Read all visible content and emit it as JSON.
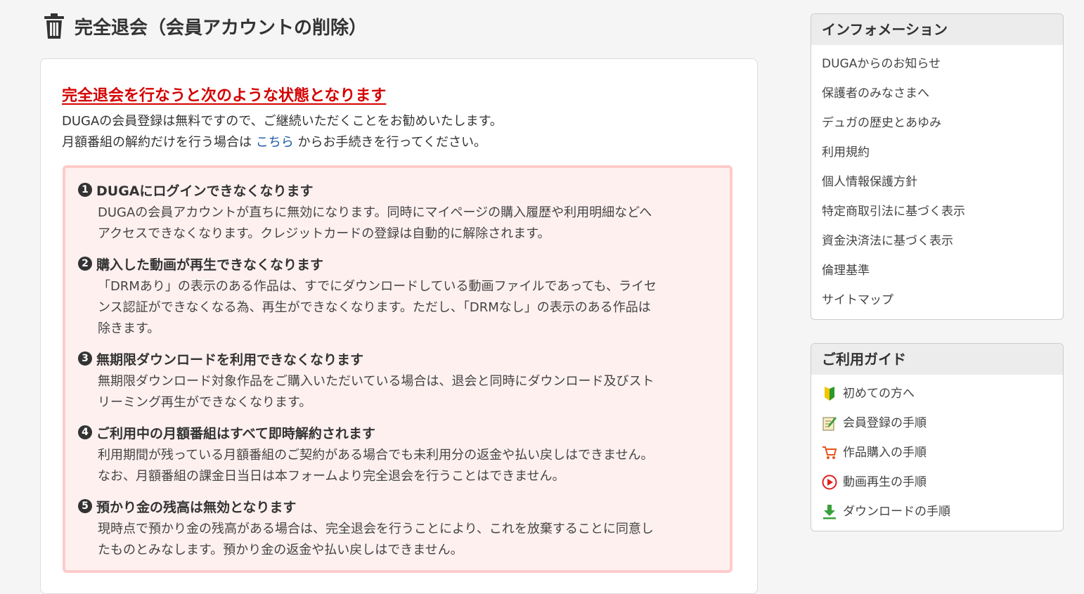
{
  "page": {
    "title": "完全退会（会員アカウントの削除）",
    "title_icon": "trash-icon"
  },
  "main": {
    "warning_heading": "完全退会を行なうと次のような状態となります",
    "intro_line1": "DUGAの会員登録は無料ですので、ご継続いただくことをお勧めいたします。",
    "intro_line2_before": "月額番組の解約だけを行う場合は",
    "intro_link": "こちら",
    "intro_line2_after": "からお手続きを行ってください。",
    "items": [
      {
        "number": "1",
        "heading": "DUGAにログインできなくなります",
        "lines": [
          "DUGAの会員アカウントが直ちに無効になります。同時にマイページの購入履歴や利用明細などへ",
          "アクセスできなくなります。クレジットカードの登録は自動的に解除されます。"
        ]
      },
      {
        "number": "2",
        "heading": "購入した動画が再生できなくなります",
        "lines": [
          "「DRMあり」の表示のある作品は、すでにダウンロードしている動画ファイルであっても、ライセ",
          "ンス認証ができなくなる為、再生ができなくなります。ただし、「DRMなし」の表示のある作品は",
          "除きます。"
        ]
      },
      {
        "number": "3",
        "heading": "無期限ダウンロードを利用できなくなります",
        "lines": [
          "無期限ダウンロード対象作品をご購入いただいている場合は、退会と同時にダウンロード及びスト",
          "リーミング再生ができなくなります。"
        ]
      },
      {
        "number": "4",
        "heading": "ご利用中の月額番組はすべて即時解約されます",
        "lines": [
          "利用期間が残っている月額番組のご契約がある場合でも未利用分の返金や払い戻しはできません。",
          "なお、月額番組の課金日当日は本フォームより完全退会を行うことはできません。"
        ]
      },
      {
        "number": "5",
        "heading": "預かり金の残高は無効となります",
        "lines": [
          "現時点で預かり金の残高がある場合は、完全退会を行うことにより、これを放棄することに同意し",
          "たものとみなします。預かり金の返金や払い戻しはできません。"
        ]
      }
    ]
  },
  "sidebar": {
    "info": {
      "heading": "インフォメーション",
      "links": [
        "DUGAからのお知らせ",
        "保護者のみなさまへ",
        "デュガの歴史とあゆみ",
        "利用規約",
        "個人情報保護方針",
        "特定商取引法に基づく表示",
        "資金決済法に基づく表示",
        "倫理基準",
        "サイトマップ"
      ]
    },
    "guide": {
      "heading": "ご利用ガイド",
      "links": [
        {
          "label": "初めての方へ",
          "icon": "beginner-mark-icon"
        },
        {
          "label": "会員登録の手順",
          "icon": "notepad-pencil-icon"
        },
        {
          "label": "作品購入の手順",
          "icon": "cart-icon"
        },
        {
          "label": "動画再生の手順",
          "icon": "play-icon"
        },
        {
          "label": "ダウンロードの手順",
          "icon": "download-icon"
        }
      ]
    }
  }
}
